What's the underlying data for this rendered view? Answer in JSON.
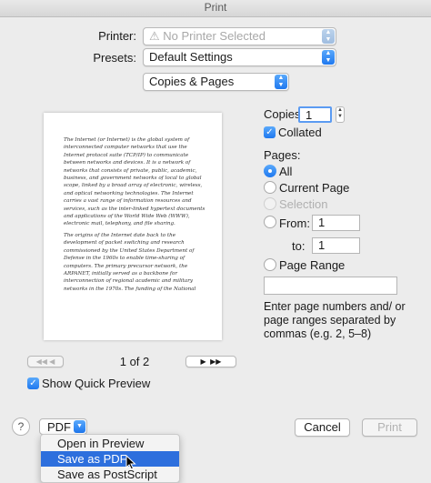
{
  "window": {
    "title": "Print"
  },
  "printer": {
    "label": "Printer:",
    "value": "⚠ No Printer Selected"
  },
  "presets": {
    "label": "Presets:",
    "value": "Default Settings"
  },
  "section": {
    "value": "Copies & Pages"
  },
  "preview": {
    "page_indicator": "1 of 2",
    "show_quick_preview": "Show Quick Preview",
    "paragraphs": [
      "The Internet (or Internet) is the global system of interconnected computer networks that use the Internet protocol suite (TCP/IP) to communicate between networks and devices. It is a network of networks that consists of private, public, academic, business, and government networks of local to global scope, linked by a broad array of electronic, wireless, and optical networking technologies. The Internet carries a vast range of information resources and services, such as the inter-linked hypertext documents and applications of the World Wide Web (WWW), electronic mail, telephony, and file sharing.",
      "The origins of the Internet date back to the development of packet switching and research commissioned by the United States Department of Defense in the 1960s to enable time-sharing of computers. The primary precursor network, the ARPANET, initially served as a backbone for interconnection of regional academic and military networks in the 1970s. The funding of the National"
    ]
  },
  "copies": {
    "label": "Copies:",
    "value": "1",
    "collated_label": "Collated"
  },
  "pages": {
    "label": "Pages:",
    "all": "All",
    "current_page": "Current Page",
    "selection": "Selection",
    "from": "From:",
    "from_value": "1",
    "to": "to:",
    "to_value": "1",
    "page_range": "Page Range",
    "hint": "Enter page numbers and/ or page ranges separated by commas (e.g. 2, 5–8)"
  },
  "footer": {
    "help": "?",
    "pdf_label": "PDF",
    "cancel": "Cancel",
    "print": "Print"
  },
  "pdf_menu": {
    "items": [
      "Open in Preview",
      "Save as PDF",
      "Save as PostScript"
    ]
  }
}
